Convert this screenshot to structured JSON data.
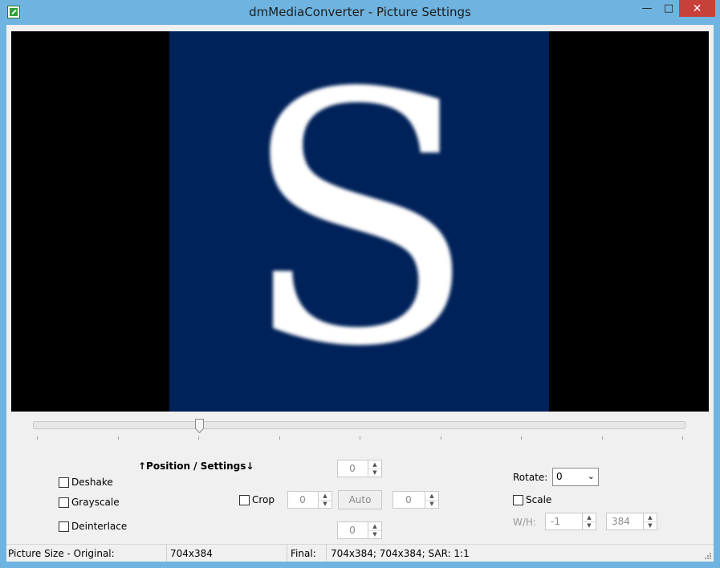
{
  "window": {
    "title": "dmMediaConverter - Picture Settings",
    "minimize_glyph": "—",
    "maximize_glyph": "□",
    "close_glyph": "✕"
  },
  "preview": {
    "letter": "S",
    "image_color": "#00225a"
  },
  "slider": {
    "position_fraction": 0.255
  },
  "heading": {
    "position_settings": "↑Position / Settings↓"
  },
  "options": {
    "deshake": {
      "label": "Deshake",
      "checked": false
    },
    "grayscale": {
      "label": "Grayscale",
      "checked": false
    },
    "deinterlace": {
      "label": "Deinterlace",
      "checked": false
    }
  },
  "crop": {
    "label": "Crop",
    "checked": false,
    "top": "0",
    "left": "0",
    "right": "0",
    "bottom": "0",
    "auto_label": "Auto"
  },
  "rotate": {
    "label": "Rotate:",
    "value": "0"
  },
  "scale": {
    "label": "Scale",
    "checked": false,
    "wh_label": "W/H:",
    "width": "-1",
    "height": "384"
  },
  "status": {
    "picture_size_label": "Picture Size - Original:",
    "original_value": "704x384",
    "final_label": "Final:",
    "final_value": "704x384; 704x384; SAR: 1:1"
  }
}
